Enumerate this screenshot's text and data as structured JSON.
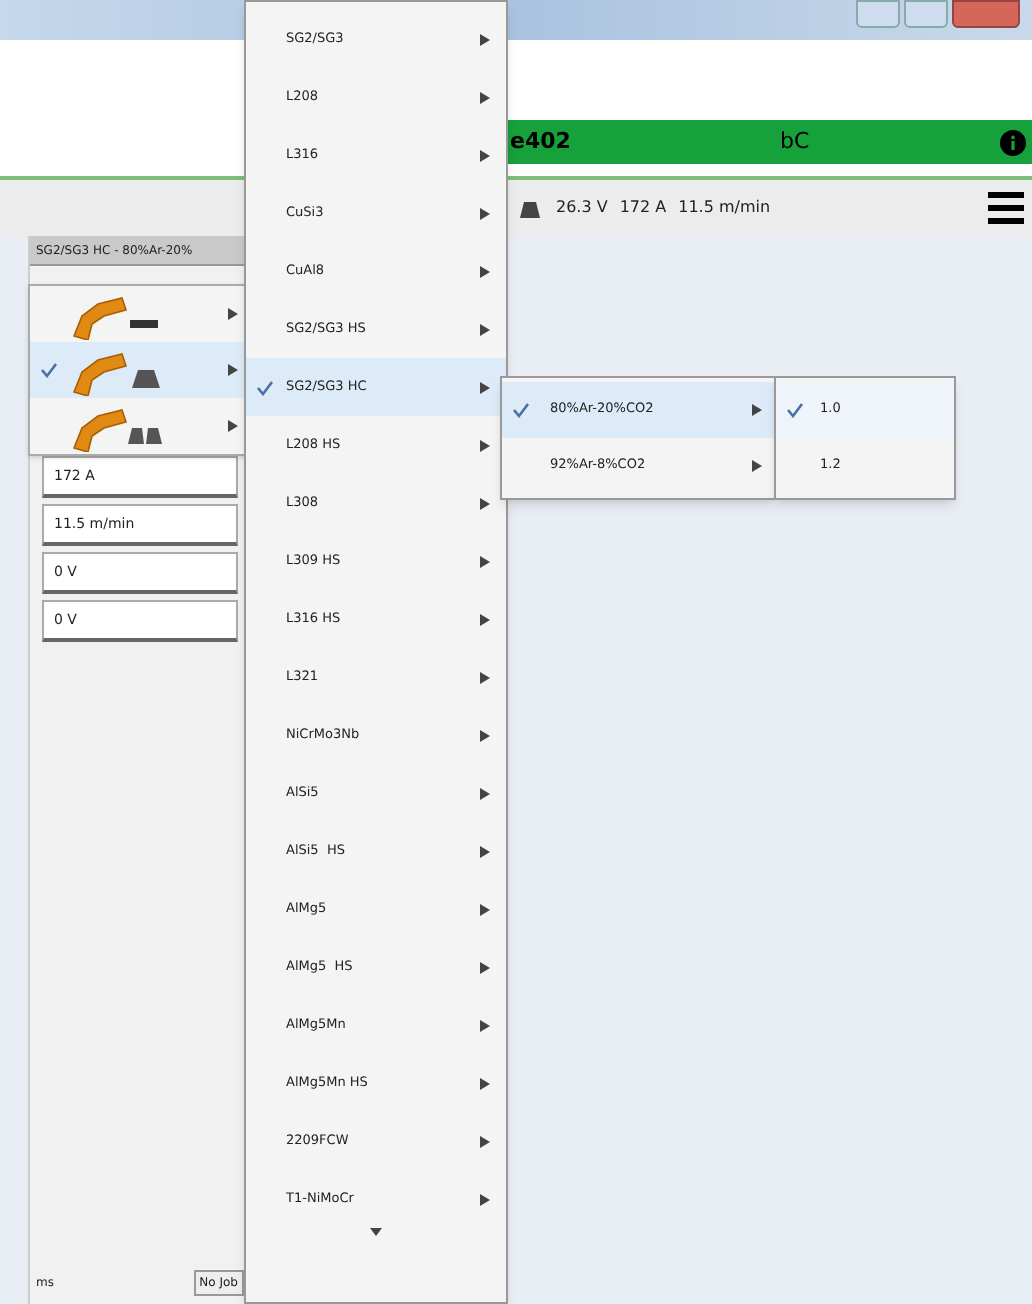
{
  "header": {
    "title": "e402",
    "mode": "bC"
  },
  "status": {
    "readings": [
      "26.3 V",
      "172 A",
      "11.5 m/min"
    ]
  },
  "panel": {
    "title": "SG2/SG3 HC - 80%Ar-20%",
    "fields": [
      {
        "value": "172 A"
      },
      {
        "value": "11.5 m/min"
      },
      {
        "value": "0 V"
      },
      {
        "value": "0 V"
      }
    ],
    "footer": {
      "left": "ms",
      "job": "No Job"
    }
  },
  "torch_menu": [
    {
      "kind": "line",
      "selected": false
    },
    {
      "kind": "single",
      "selected": true
    },
    {
      "kind": "double",
      "selected": false
    }
  ],
  "material_menu": [
    {
      "label": "SG2/SG3",
      "selected": false
    },
    {
      "label": "L208",
      "selected": false
    },
    {
      "label": "L316",
      "selected": false
    },
    {
      "label": "CuSi3",
      "selected": false
    },
    {
      "label": "CuAl8",
      "selected": false
    },
    {
      "label": "SG2/SG3 HS",
      "selected": false
    },
    {
      "label": "SG2/SG3 HC",
      "selected": true
    },
    {
      "label": "L208 HS",
      "selected": false
    },
    {
      "label": "L308",
      "selected": false
    },
    {
      "label": "L309 HS",
      "selected": false
    },
    {
      "label": "L316 HS",
      "selected": false
    },
    {
      "label": "L321",
      "selected": false
    },
    {
      "label": "NiCrMo3Nb",
      "selected": false
    },
    {
      "label": "AlSi5",
      "selected": false
    },
    {
      "label": "AlSi5  HS",
      "selected": false
    },
    {
      "label": "AlMg5",
      "selected": false
    },
    {
      "label": "AlMg5  HS",
      "selected": false
    },
    {
      "label": "AlMg5Mn",
      "selected": false
    },
    {
      "label": "AlMg5Mn HS",
      "selected": false
    },
    {
      "label": "2209FCW",
      "selected": false
    },
    {
      "label": "T1-NiMoCr",
      "selected": false
    }
  ],
  "gas_menu": [
    {
      "label": "80%Ar-20%CO2",
      "selected": true
    },
    {
      "label": "92%Ar-8%CO2",
      "selected": false
    }
  ],
  "wire_menu": [
    {
      "label": "1.0",
      "selected": true
    },
    {
      "label": "1.2",
      "selected": false
    }
  ]
}
